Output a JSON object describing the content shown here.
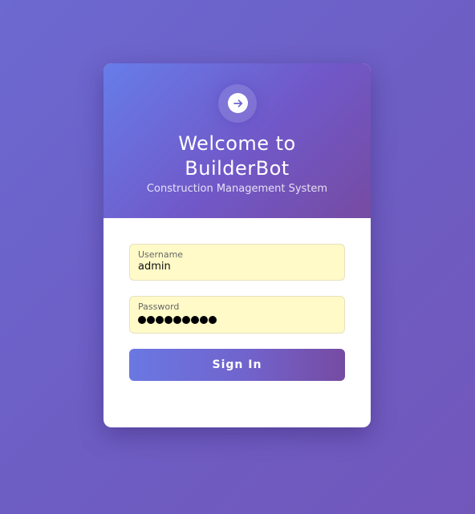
{
  "header": {
    "title_line1": "Welcome to",
    "title_line2": "BuilderBot",
    "subtitle": "Construction Management System",
    "icon": "arrow-right-circle-icon"
  },
  "form": {
    "username": {
      "label": "Username",
      "value": "admin"
    },
    "password": {
      "label": "Password",
      "masked_length": 9
    },
    "submit_label": "Sign In"
  },
  "colors": {
    "background": "#6d5ec4",
    "header_gradient_start": "#667de9",
    "header_gradient_end": "#764ba2",
    "field_background": "#fffac8",
    "button_gradient_start": "#6a78e2",
    "button_gradient_end": "#764ba2"
  }
}
